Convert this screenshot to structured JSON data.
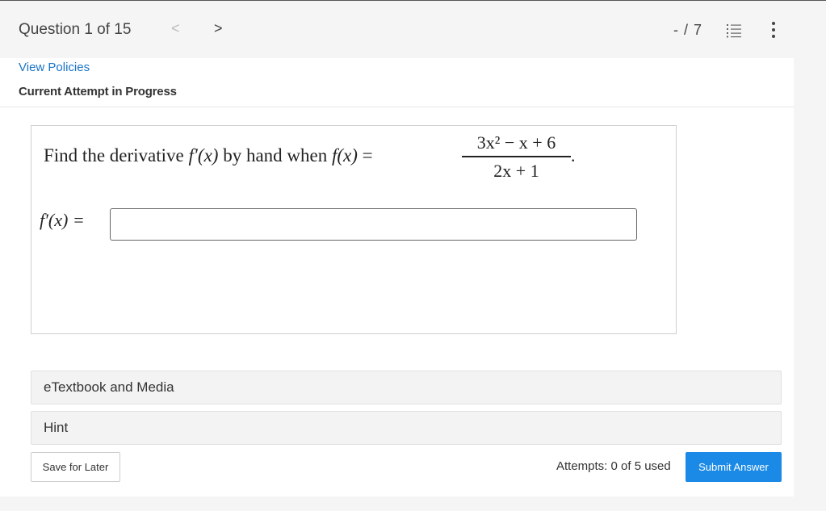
{
  "header": {
    "question_label": "Question 1 of 15",
    "prev_glyph": "<",
    "next_glyph": ">",
    "score": "- / 7",
    "list_icon": "list-icon",
    "more_icon": "more-vertical-icon"
  },
  "policies": {
    "link_label": "View Policies",
    "attempt_status": "Current Attempt in Progress"
  },
  "question": {
    "prompt_start": "Find the derivative ",
    "prompt_fprime": "f′(x)",
    "prompt_middle": " by hand when ",
    "prompt_fx": "f(x)",
    "prompt_equals": " =",
    "numerator": "3x² − x + 6",
    "denominator": "2x + 1",
    "period": ".",
    "answer_label": "f′(x) =",
    "answer_value": ""
  },
  "resources": {
    "media_label": "eTextbook and Media",
    "hint_label": "Hint"
  },
  "footer": {
    "save_label": "Save for Later",
    "attempts_text": "Attempts: 0 of 5 used",
    "submit_label": "Submit Answer"
  },
  "colors": {
    "accent": "#1a8ae6",
    "link": "#1a73c8"
  }
}
